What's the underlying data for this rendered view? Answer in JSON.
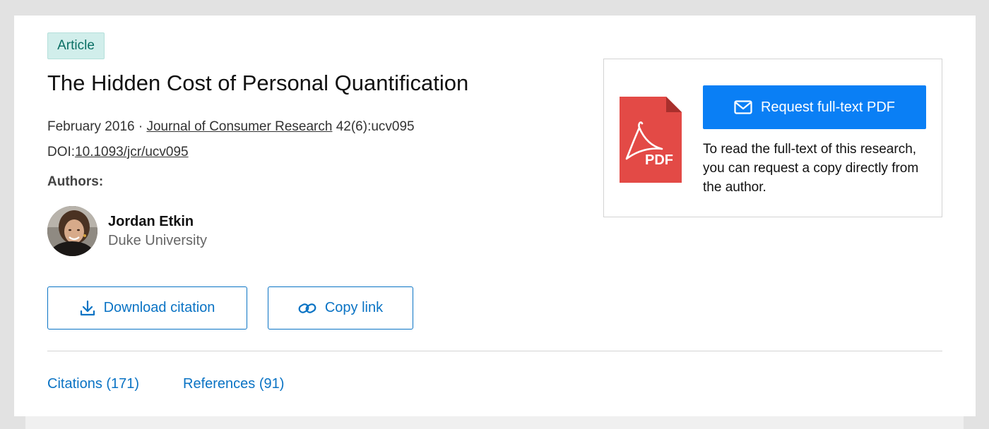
{
  "badge": {
    "label": "Article"
  },
  "article": {
    "title": "The Hidden Cost of Personal Quantification",
    "date": "February 2016",
    "separator": " · ",
    "journal": "Journal of Consumer Research",
    "issue": " 42(6):ucv095",
    "doi_label": "DOI:",
    "doi": "10.1093/jcr/ucv095"
  },
  "authors": {
    "label": "Authors:",
    "items": [
      {
        "name": "Jordan Etkin",
        "institution": "Duke University"
      }
    ]
  },
  "actions": {
    "download_citation": "Download citation",
    "copy_link": "Copy link"
  },
  "tabs": [
    {
      "label": "Citations (171)"
    },
    {
      "label": "References (91)"
    }
  ],
  "pdf_panel": {
    "icon_label": "PDF",
    "request_button": "Request full-text PDF",
    "description": "To read the full-text of this research, you can request a copy directly from the author."
  },
  "colors": {
    "accent": "#0a73c4",
    "primary_button": "#0a7ff5",
    "badge_bg": "#d1eeeb",
    "badge_text": "#0a6f64",
    "pdf_red": "#e34a46"
  },
  "icons": {
    "download": "download-icon",
    "copy_link": "link-icon",
    "request": "envelope-icon",
    "pdf": "pdf-file-icon"
  }
}
